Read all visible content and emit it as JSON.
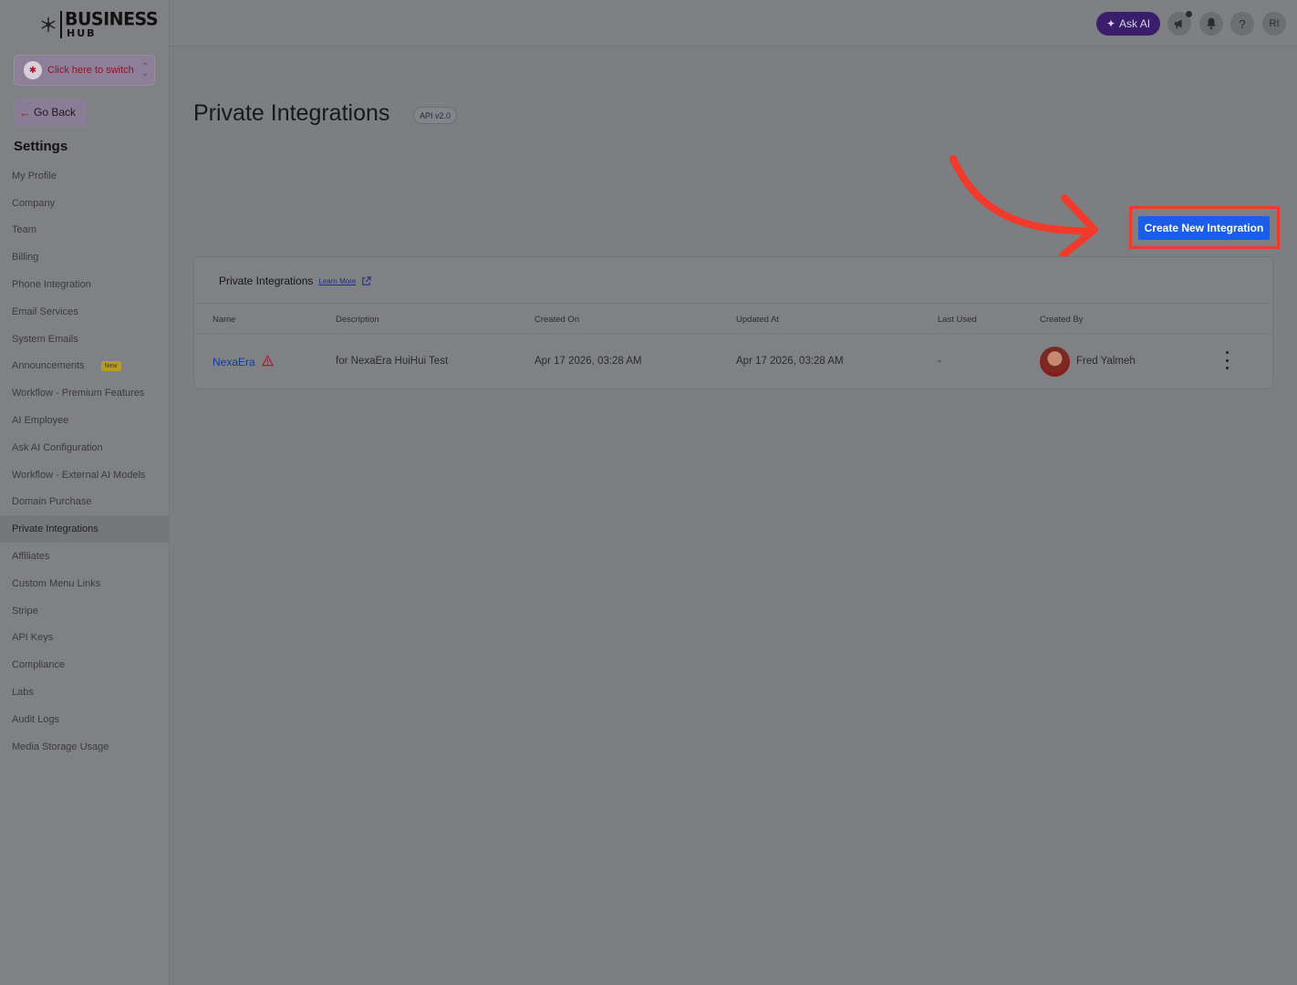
{
  "brand": {
    "line1": "BUSINESS",
    "line2": "HUB"
  },
  "switcher": {
    "label": "Click here to switch"
  },
  "sidebar": {
    "go_back": "Go Back",
    "title": "Settings",
    "new_badge": "New",
    "items": [
      {
        "label": "My Profile"
      },
      {
        "label": "Company"
      },
      {
        "label": "Team"
      },
      {
        "label": "Billing"
      },
      {
        "label": "Phone Integration"
      },
      {
        "label": "Email Services"
      },
      {
        "label": "System Emails"
      },
      {
        "label": "Announcements"
      },
      {
        "label": "Workflow - Premium Features"
      },
      {
        "label": "AI Employee"
      },
      {
        "label": "Ask AI Configuration"
      },
      {
        "label": "Workflow - External AI Models"
      },
      {
        "label": "Domain Purchase"
      },
      {
        "label": "Private Integrations"
      },
      {
        "label": "Affiliates"
      },
      {
        "label": "Custom Menu Links"
      },
      {
        "label": "Stripe"
      },
      {
        "label": "API Keys"
      },
      {
        "label": "Compliance"
      },
      {
        "label": "Labs"
      },
      {
        "label": "Audit Logs"
      },
      {
        "label": "Media Storage Usage"
      }
    ]
  },
  "topbar": {
    "ask_ai": "Ask AI",
    "help": "?",
    "user_initials": "RI"
  },
  "page": {
    "title": "Private Integrations",
    "api_badge": "API v2.0",
    "create_button": "Create New Integration"
  },
  "card": {
    "title": "Private Integrations",
    "learn_more": "Learn More",
    "columns": [
      "Name",
      "Description",
      "Created On",
      "Updated At",
      "Last Used",
      "Created By"
    ],
    "rows": [
      {
        "name": "NexaEra",
        "description": "for NexaEra HuiHui Test",
        "created_on": "Apr 17 2026, 03:28 AM",
        "updated_at": "Apr 17 2026, 03:28 AM",
        "last_used": "-",
        "created_by": "Fred Yalmeh"
      }
    ]
  },
  "colors": {
    "accent_blue": "#1a5de8",
    "annotation_red": "#f23a2b",
    "ask_ai_purple": "#3a1e6b"
  }
}
